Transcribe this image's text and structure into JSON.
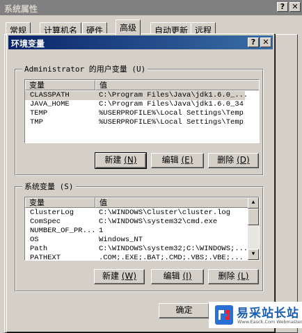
{
  "outer": {
    "title": "系统属性",
    "help_btn": "?",
    "close_btn": "✕",
    "tabs": [
      "常规",
      "计算机名",
      "硬件",
      "高级",
      "自动更新",
      "远程"
    ],
    "ok_label": "确定"
  },
  "dialog": {
    "title": "环境变量",
    "help_btn": "?",
    "close_btn": "✕"
  },
  "user_vars": {
    "legend": "Administrator 的用户变量 (U)",
    "col_var": "变量",
    "col_val": "值",
    "rows": [
      {
        "name": "CLASSPATH",
        "value": "C:\\Program Files\\Java\\jdk1.6.0_..."
      },
      {
        "name": "JAVA_HOME",
        "value": "C:\\Program Files\\Java\\jdk1.6.0_34"
      },
      {
        "name": "TEMP",
        "value": "%USERPROFILE%\\Local Settings\\Temp"
      },
      {
        "name": "TMP",
        "value": "%USERPROFILE%\\Local Settings\\Temp"
      }
    ],
    "new_btn": "新建",
    "new_key": "(N)",
    "edit_btn": "编辑",
    "edit_key": "(E)",
    "del_btn": "删除",
    "del_key": "(D)"
  },
  "sys_vars": {
    "legend": "系统变量 (S)",
    "col_var": "变量",
    "col_val": "值",
    "rows": [
      {
        "name": "ClusterLog",
        "value": "C:\\WINDOWS\\Cluster\\cluster.log"
      },
      {
        "name": "ComSpec",
        "value": "C:\\WINDOWS\\system32\\cmd.exe"
      },
      {
        "name": "NUMBER_OF_PR...",
        "value": "1"
      },
      {
        "name": "OS",
        "value": "Windows_NT"
      },
      {
        "name": "Path",
        "value": "C:\\WINDOWS\\system32;C:\\WINDOWS;..."
      },
      {
        "name": "PATHEXT",
        "value": ".COM;.EXE;.BAT;.CMD;.VBS;.VBE;..."
      }
    ],
    "new_btn": "新建",
    "new_key": "(W)",
    "edit_btn": "编辑",
    "edit_key": "(I)",
    "del_btn": "删除",
    "del_key": "(L)"
  },
  "watermark": {
    "text": "易采站长站",
    "url": "Www.Easck.Com Webmaster"
  }
}
